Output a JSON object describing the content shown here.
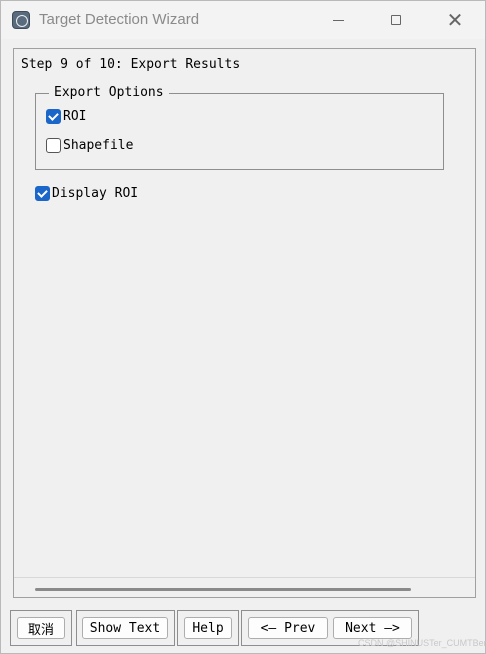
{
  "window": {
    "title": "Target Detection Wizard",
    "icon": "app-icon",
    "controls": [
      "minimize-icon",
      "maximize-icon",
      "close-icon"
    ]
  },
  "panel": {
    "step_label": "Step 9 of 10: Export Results",
    "group": {
      "legend": "Export Options",
      "options": [
        {
          "label": "ROI",
          "checked": true
        },
        {
          "label": "Shapefile",
          "checked": false
        }
      ]
    },
    "display_roi": {
      "label": "Display ROI",
      "checked": true
    }
  },
  "buttons": {
    "cancel": "取消",
    "show_text": "Show Text",
    "help": "Help",
    "prev": "<— Prev",
    "next": "Next —>"
  },
  "watermark": "CSDN @SHINUSTer_CUMTBer",
  "colors": {
    "accent": "#1a66c9",
    "background": "#f0f0f0"
  }
}
